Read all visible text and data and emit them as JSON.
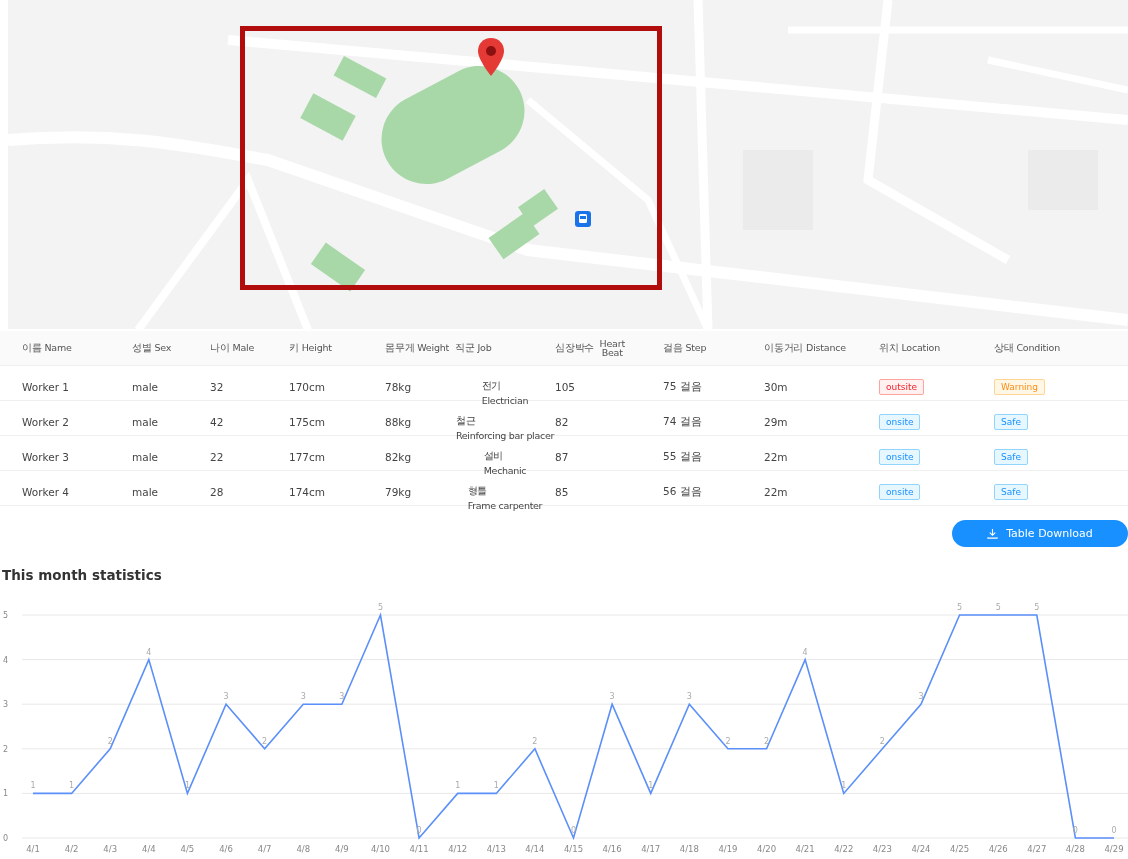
{
  "table": {
    "columns": [
      {
        "ko": "이름",
        "en": "Name"
      },
      {
        "ko": "성별",
        "en": "Sex"
      },
      {
        "ko": "나이",
        "en": "Male"
      },
      {
        "ko": "키",
        "en": "Height"
      },
      {
        "ko": "몸무게",
        "en": "Weight"
      },
      {
        "ko": "직군",
        "en": "Job"
      },
      {
        "ko": "심장박수",
        "en": "Heart Beat"
      },
      {
        "ko": "걸음",
        "en": "Step"
      },
      {
        "ko": "이동거리",
        "en": "Distance"
      },
      {
        "ko": "위치",
        "en": "Location"
      },
      {
        "ko": "상태",
        "en": "Condition"
      }
    ],
    "rows": [
      {
        "name": "Worker 1",
        "sex": "male",
        "age": "32",
        "height": "170cm",
        "weight": "78kg",
        "job_ko": "전기",
        "job_en": "Electrician",
        "heart": "105",
        "step": "75 걸음",
        "distance": "30m",
        "location": {
          "text": "outsite",
          "kind": "error"
        },
        "condition": {
          "text": "Warning",
          "kind": "warning"
        }
      },
      {
        "name": "Worker 2",
        "sex": "male",
        "age": "42",
        "height": "175cm",
        "weight": "88kg",
        "job_ko": "철근",
        "job_en": "Reinforcing bar placer",
        "heart": "82",
        "step": "74 걸음",
        "distance": "29m",
        "location": {
          "text": "onsite",
          "kind": "info"
        },
        "condition": {
          "text": "Safe",
          "kind": "info"
        }
      },
      {
        "name": "Worker 3",
        "sex": "male",
        "age": "22",
        "height": "177cm",
        "weight": "82kg",
        "job_ko": "설비",
        "job_en": "Mechanic",
        "heart": "87",
        "step": "55 걸음",
        "distance": "22m",
        "location": {
          "text": "onsite",
          "kind": "info"
        },
        "condition": {
          "text": "Safe",
          "kind": "info"
        }
      },
      {
        "name": "Worker 4",
        "sex": "male",
        "age": "28",
        "height": "174cm",
        "weight": "79kg",
        "job_ko": "형틀",
        "job_en": "Frame carpenter",
        "heart": "85",
        "step": "56 걸음",
        "distance": "22m",
        "location": {
          "text": "onsite",
          "kind": "info"
        },
        "condition": {
          "text": "Safe",
          "kind": "info"
        }
      }
    ]
  },
  "download_button": "Table Download",
  "statistics": {
    "title": "This month statistics",
    "chart_data": {
      "type": "line",
      "categories": [
        "4/1",
        "4/2",
        "4/3",
        "4/4",
        "4/5",
        "4/6",
        "4/7",
        "4/8",
        "4/9",
        "4/10",
        "4/11",
        "4/12",
        "4/13",
        "4/14",
        "4/15",
        "4/16",
        "4/17",
        "4/18",
        "4/19",
        "4/20",
        "4/21",
        "4/22",
        "4/23",
        "4/24",
        "4/25",
        "4/26",
        "4/27",
        "4/28",
        "4/29"
      ],
      "series": [
        {
          "color": "#5b8ff9",
          "values": [
            1,
            1,
            2,
            4,
            1,
            3,
            2,
            3,
            3,
            5,
            0,
            1,
            1,
            2,
            0,
            3,
            1,
            3,
            2,
            2,
            4,
            1,
            2,
            3,
            5,
            5,
            5,
            0,
            0
          ]
        }
      ],
      "grid": true,
      "ylim": [
        0,
        5
      ],
      "yticks": [
        0,
        1,
        2,
        3,
        4,
        5
      ],
      "data_labels": true
    }
  }
}
